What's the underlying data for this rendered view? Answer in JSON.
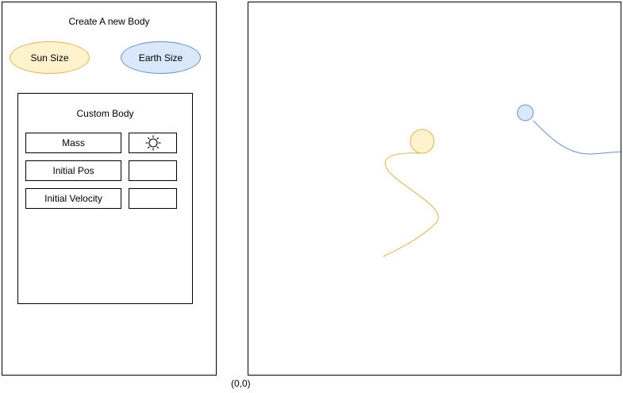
{
  "sidebar": {
    "title": "Create A new Body",
    "presets": [
      {
        "label": "Sun Size",
        "color": "#fff2cc",
        "stroke": "#d6b656"
      },
      {
        "label": "Earth Size",
        "color": "#dae8fc",
        "stroke": "#6c8ebf"
      }
    ],
    "custom_body": {
      "title": "Custom Body",
      "fields": [
        {
          "label": "Mass",
          "value": "",
          "icon": "sun-icon"
        },
        {
          "label": "Initial Pos",
          "value": ""
        },
        {
          "label": "Initial Velocity",
          "value": ""
        }
      ]
    }
  },
  "simulation": {
    "origin_label": "(0,0)",
    "bodies": [
      {
        "name": "sun",
        "fill": "#fff2cc",
        "stroke": "#d6b656",
        "trail_color": "#d6b656"
      },
      {
        "name": "earth",
        "fill": "#dae8fc",
        "stroke": "#6c8ebf",
        "trail_color": "#6c8ebf"
      }
    ]
  }
}
